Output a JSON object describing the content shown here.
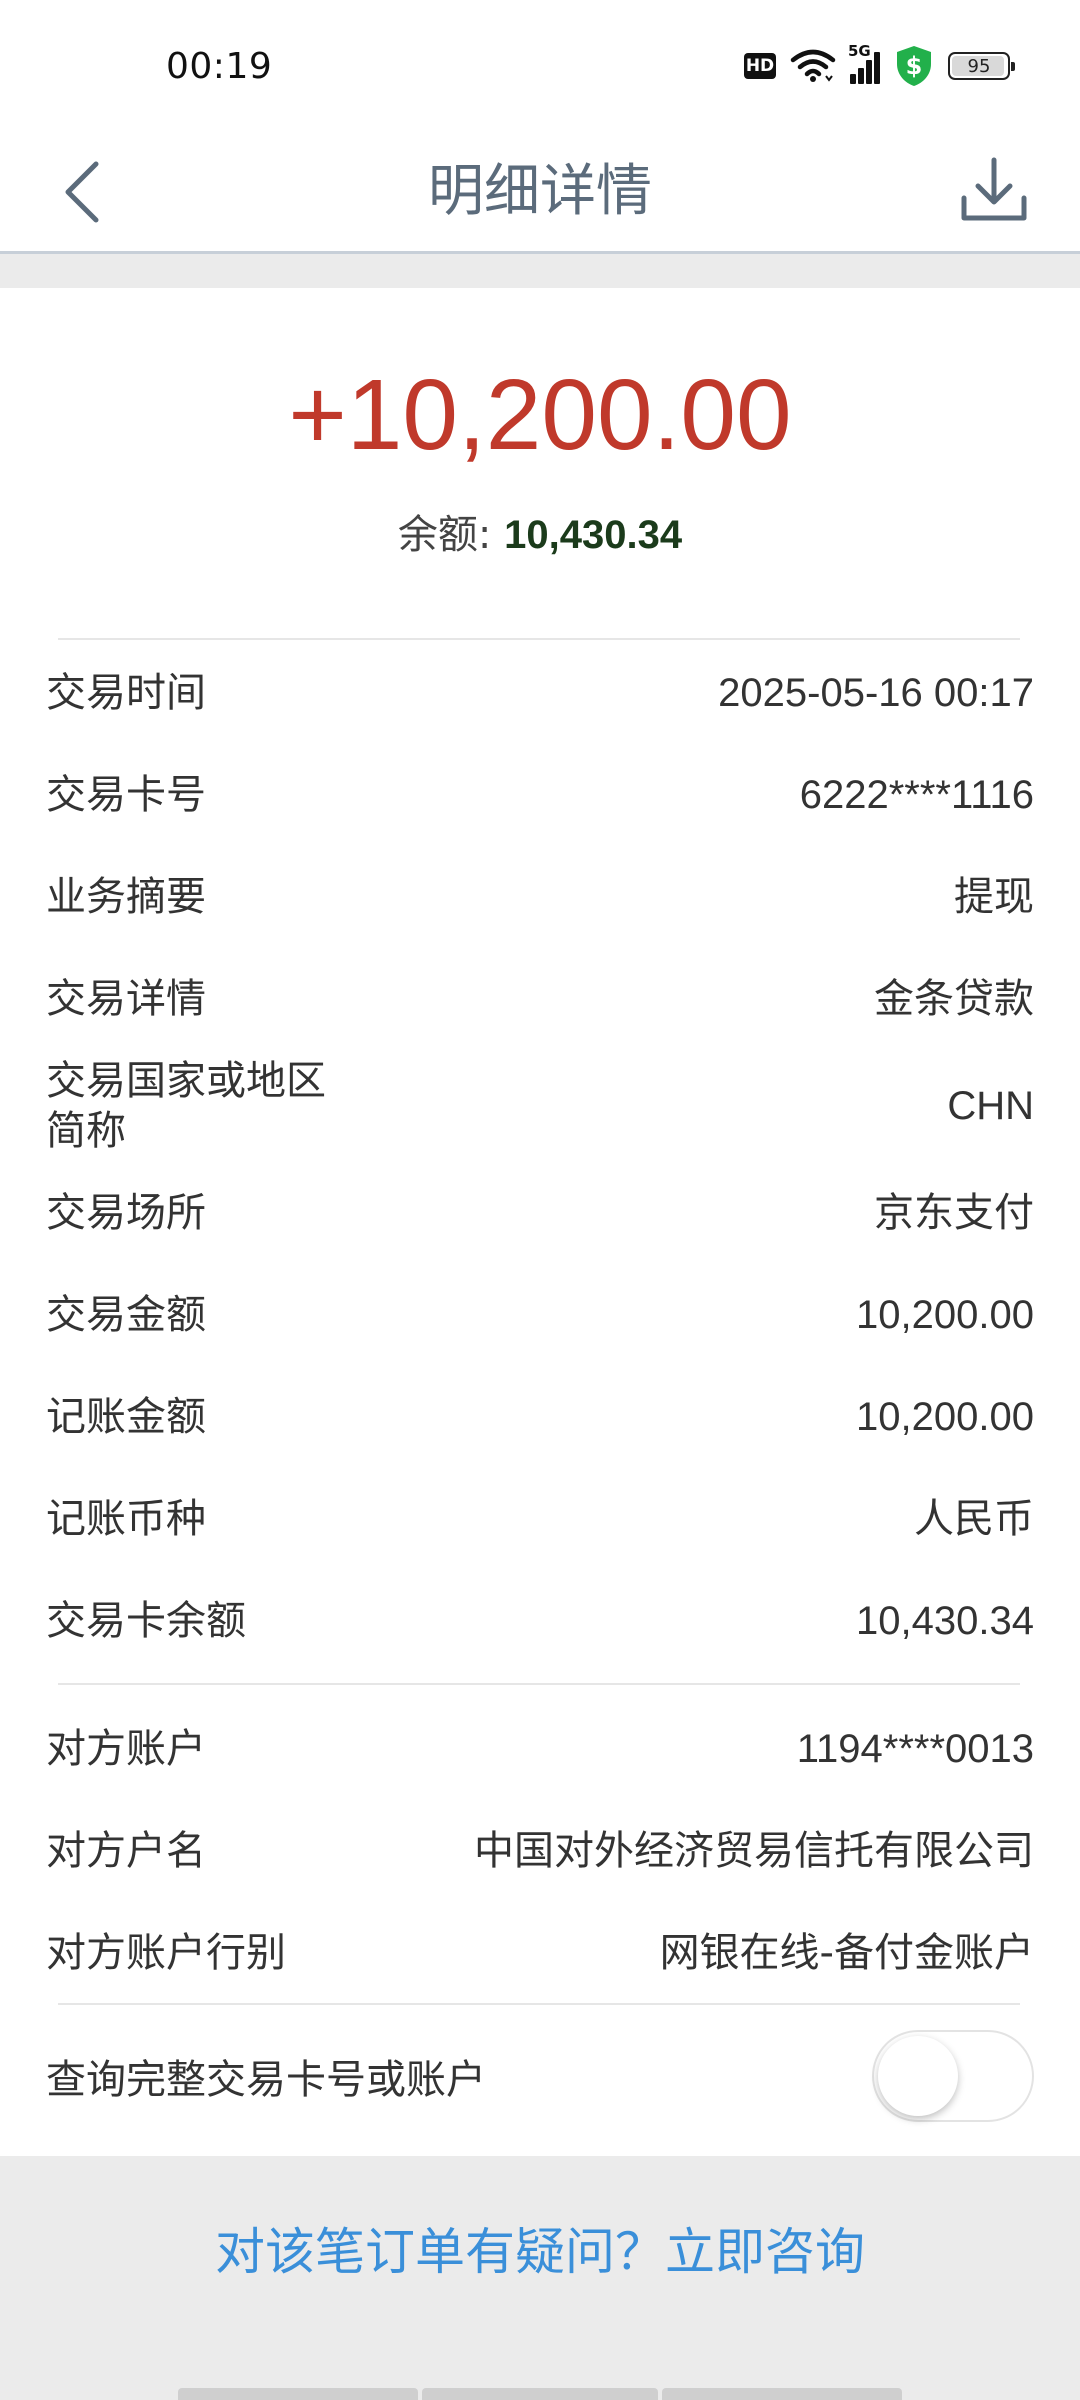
{
  "status_bar": {
    "time": "00:19",
    "network": "5G",
    "hd_label": "HD",
    "battery": "95",
    "icons": [
      "hd-icon",
      "wifi-icon",
      "signal-icon",
      "shield-dollar-icon",
      "battery-icon"
    ]
  },
  "header": {
    "title": "明细详情",
    "back_icon": "chevron-left-icon",
    "download_icon": "download-icon"
  },
  "summary": {
    "amount": "+10,200.00",
    "balance_label": "余额: ",
    "balance_value": "10,430.34"
  },
  "details": [
    {
      "label": "交易时间",
      "value": "2025-05-16 00:17"
    },
    {
      "label": "交易卡号",
      "value": "6222****1116"
    },
    {
      "label": "业务摘要",
      "value": "提现"
    },
    {
      "label": "交易详情",
      "value": "金条贷款"
    },
    {
      "label": "交易国家或地区\n简称",
      "value": "CHN"
    },
    {
      "label": "交易场所",
      "value": "京东支付"
    },
    {
      "label": "交易金额",
      "value": "10,200.00"
    },
    {
      "label": "记账金额",
      "value": "10,200.00"
    },
    {
      "label": "记账币种",
      "value": "人民币"
    },
    {
      "label": "交易卡余额",
      "value": "10,430.34"
    }
  ],
  "counterparty": [
    {
      "label": "对方账户",
      "value": "1194****0013"
    },
    {
      "label": "对方户名",
      "value": "中国对外经济贸易信托有限公司"
    },
    {
      "label": "对方账户行别",
      "value": "网银在线-备付金账户"
    }
  ],
  "full_query": {
    "label": "查询完整交易卡号或账户",
    "toggle_on": false
  },
  "footer": {
    "consult_text": "对该笔订单有疑问？立即咨询"
  },
  "colors": {
    "amount": "#c0392b",
    "balance_value": "#1b3b1b",
    "link": "#3a8fd9",
    "title": "#5b6b7b"
  }
}
